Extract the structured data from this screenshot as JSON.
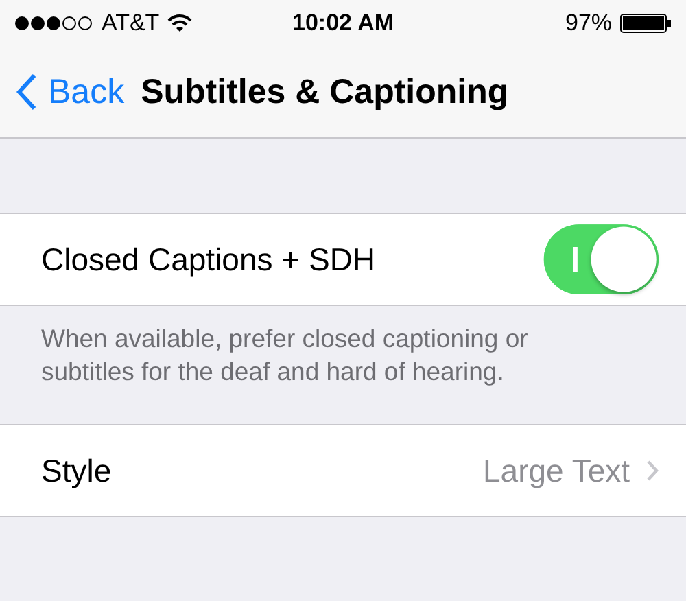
{
  "status_bar": {
    "carrier": "AT&T",
    "time": "10:02 AM",
    "battery": "97%"
  },
  "nav_bar": {
    "back": "Back",
    "title": "Subtitles & Captioning"
  },
  "caption_row": {
    "label": "Closed Captions + SDH",
    "on": true
  },
  "caption_footer": "When available, prefer closed captioning or subtitles for the deaf and hard of hearing.",
  "style_row": {
    "label": "Style",
    "value": "Large Text"
  }
}
